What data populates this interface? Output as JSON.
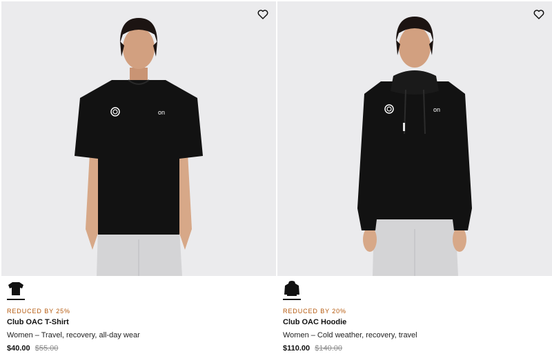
{
  "products": [
    {
      "badge": "REDUCED BY 25%",
      "name": "Club OAC T-Shirt",
      "subtitle": "Women – Travel, recovery, all-day wear",
      "price": "$40.00",
      "original_price": "$55.00",
      "garment": "tshirt",
      "wishlist_icon": "heart-outline-icon"
    },
    {
      "badge": "REDUCED BY 20%",
      "name": "Club OAC Hoodie",
      "subtitle": "Women – Cold weather, recovery, travel",
      "price": "$110.00",
      "original_price": "$140.00",
      "garment": "hoodie",
      "wishlist_icon": "heart-outline-icon"
    }
  ],
  "colors": {
    "image_background": "#ebebed",
    "badge": "#b4570a",
    "text": "#111111",
    "strikethrough": "#8a8a8a"
  }
}
